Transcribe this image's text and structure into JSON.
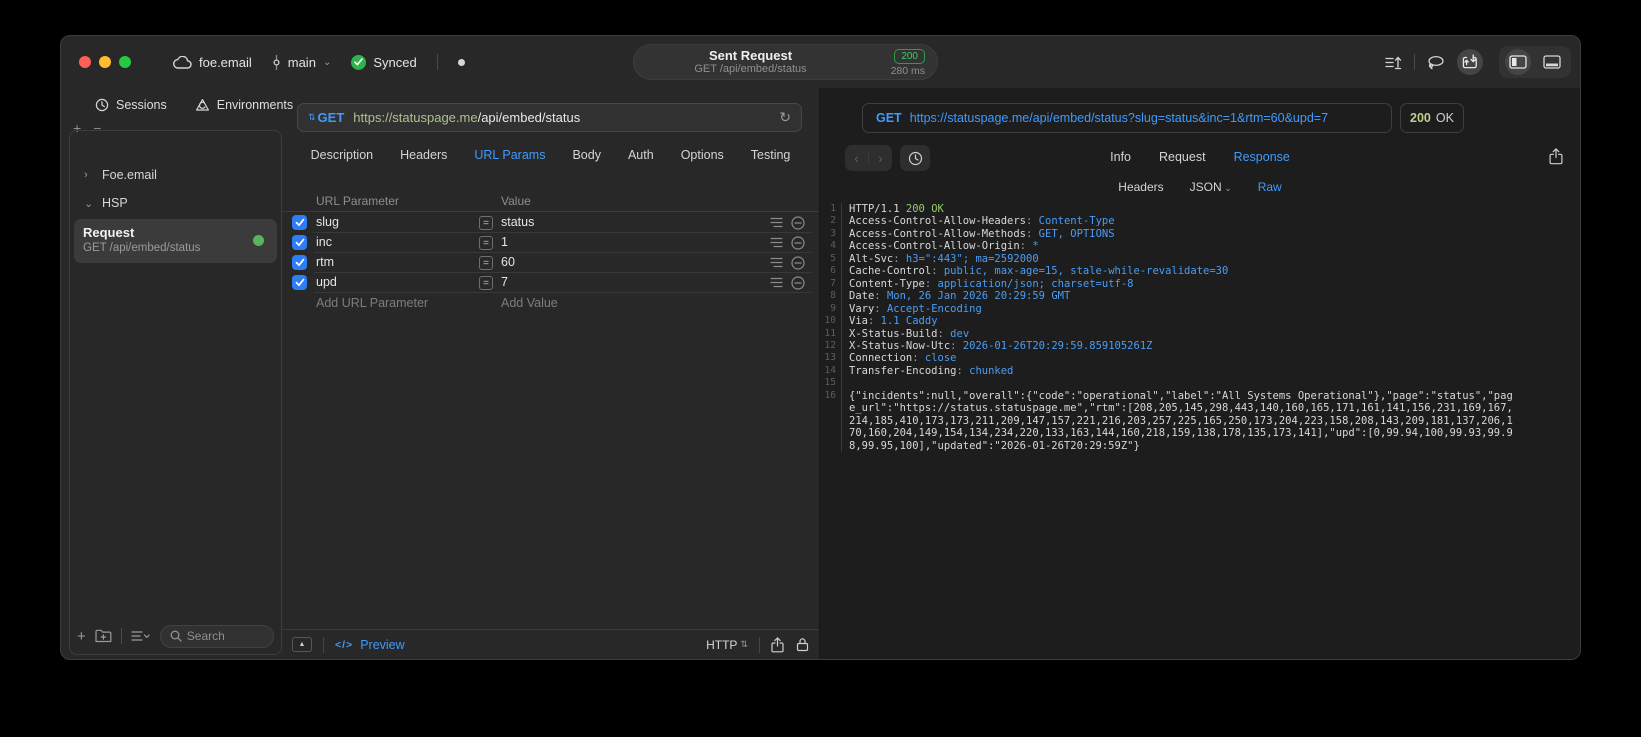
{
  "colors": {
    "accent_blue": "#3e9bff",
    "status_green": "#35d158",
    "checkbox_blue": "#2e7cf6",
    "url_host_green": "#aec28e",
    "response_value_blue": "#4a9df5",
    "response_status_green": "#94c96a",
    "traffic_close": "#ff5f57",
    "traffic_minimize": "#febc2e",
    "traffic_zoom": "#28c840"
  },
  "titlebar": {
    "project": "foe.email",
    "branch": "main",
    "sync_label": "Synced",
    "center": {
      "title": "Sent Request",
      "subtitle": "GET /api/embed/status",
      "status_code": "200",
      "duration": "280 ms"
    }
  },
  "sidebar": {
    "tabs": [
      {
        "label": "Sessions"
      },
      {
        "label": "Environments"
      }
    ],
    "tree": [
      {
        "label": "Foe.email",
        "expanded": false
      },
      {
        "label": "HSP",
        "expanded": true
      }
    ],
    "request": {
      "title": "Request",
      "subtitle": "GET /api/embed/status"
    },
    "search_placeholder": "Search"
  },
  "request_editor": {
    "method": "GET",
    "url_host": "https://statuspage.me",
    "url_path": "/api/embed/status",
    "tabs": [
      "Description",
      "Headers",
      "URL Params",
      "Body",
      "Auth",
      "Options",
      "Testing"
    ],
    "active_tab": "URL Params",
    "params": {
      "col_param": "URL Parameter",
      "col_value": "Value",
      "rows": [
        {
          "name": "slug",
          "value": "status",
          "checked": true
        },
        {
          "name": "inc",
          "value": "1",
          "checked": true
        },
        {
          "name": "rtm",
          "value": "60",
          "checked": true
        },
        {
          "name": "upd",
          "value": "7",
          "checked": true
        }
      ],
      "add_name": "Add URL Parameter",
      "add_value": "Add Value"
    },
    "footer": {
      "preview": "Preview",
      "protocol": "HTTP"
    }
  },
  "response_viewer": {
    "method": "GET",
    "url": "https://statuspage.me/api/embed/status?slug=status&inc=1&rtm=60&upd=7",
    "status_code": "200",
    "status_text": "OK",
    "tabs": [
      "Info",
      "Request",
      "Response"
    ],
    "active_tab": "Response",
    "subtabs": [
      {
        "label": "Headers"
      },
      {
        "label": "JSON",
        "has_chevron": true
      },
      {
        "label": "Raw"
      }
    ],
    "active_subtab": "Raw",
    "status_line": {
      "protocol": "HTTP/1.1",
      "status": "200 OK"
    },
    "headers": [
      {
        "name": "Access-Control-Allow-Headers",
        "value": "Content-Type"
      },
      {
        "name": "Access-Control-Allow-Methods",
        "value": "GET, OPTIONS"
      },
      {
        "name": "Access-Control-Allow-Origin",
        "value": "*"
      },
      {
        "name": "Alt-Svc",
        "value": "h3=\":443\"; ma=2592000"
      },
      {
        "name": "Cache-Control",
        "value": "public, max-age=15, stale-while-revalidate=30"
      },
      {
        "name": "Content-Type",
        "value": "application/json; charset=utf-8"
      },
      {
        "name": "Date",
        "value": "Mon, 26 Jan 2026 20:29:59 GMT"
      },
      {
        "name": "Vary",
        "value": "Accept-Encoding"
      },
      {
        "name": "Via",
        "value": "1.1 Caddy"
      },
      {
        "name": "X-Status-Build",
        "value": "dev"
      },
      {
        "name": "X-Status-Now-Utc",
        "value": "2026-01-26T20:29:59.859105261Z"
      },
      {
        "name": "Connection",
        "value": "close"
      },
      {
        "name": "Transfer-Encoding",
        "value": "chunked"
      }
    ],
    "body": "{\"incidents\":null,\"overall\":{\"code\":\"operational\",\"label\":\"All Systems Operational\"},\"page\":\"status\",\"page_url\":\"https://status.statuspage.me\",\"rtm\":[208,205,145,298,443,140,160,165,171,161,141,156,231,169,167,214,185,410,173,173,211,209,147,157,221,216,203,257,225,165,250,173,204,223,158,208,143,209,181,137,206,170,160,204,149,154,134,234,220,133,163,144,160,218,159,138,178,135,173,141],\"upd\":[0,99.94,100,99.93,99.98,99.95,100],\"updated\":\"2026-01-26T20:29:59Z\"}"
  }
}
